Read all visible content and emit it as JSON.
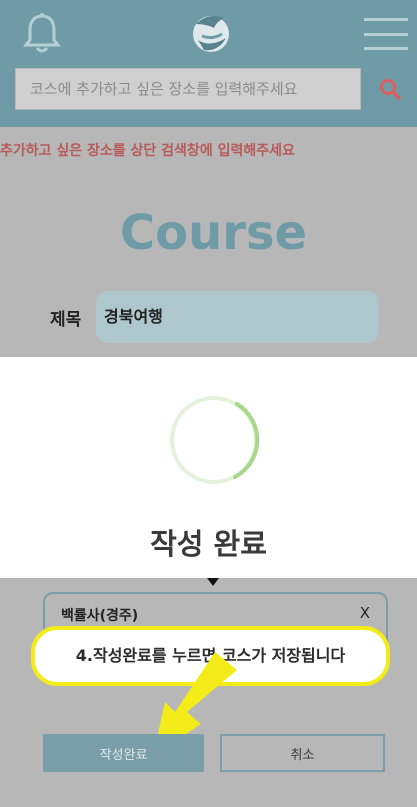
{
  "header": {
    "bell_icon": "bell-icon",
    "logo_icon": "dolphin-logo-icon",
    "menu_icon": "hamburger-menu-icon",
    "color": "#6e9ba6"
  },
  "search": {
    "placeholder": "코스에 추가하고 싶은 장소를 입력해주세요",
    "icon": "search-icon",
    "icon_color": "#e05a5a"
  },
  "hint": "추가하고 싶은 장소를 상단 검색창에 입력해주세요",
  "course": {
    "heading": "Course",
    "title_label": "제목",
    "title_value": "경북여행"
  },
  "modal": {
    "message": "작성 완료"
  },
  "place": {
    "name": "백률사(경주)",
    "close_label": "X"
  },
  "tooltip": {
    "text": "4.작성완료를 누르면 코스가 저장됩니다",
    "border_color": "#f4ec18"
  },
  "buttons": {
    "complete_label": "작성완료",
    "cancel_label": "취소"
  }
}
